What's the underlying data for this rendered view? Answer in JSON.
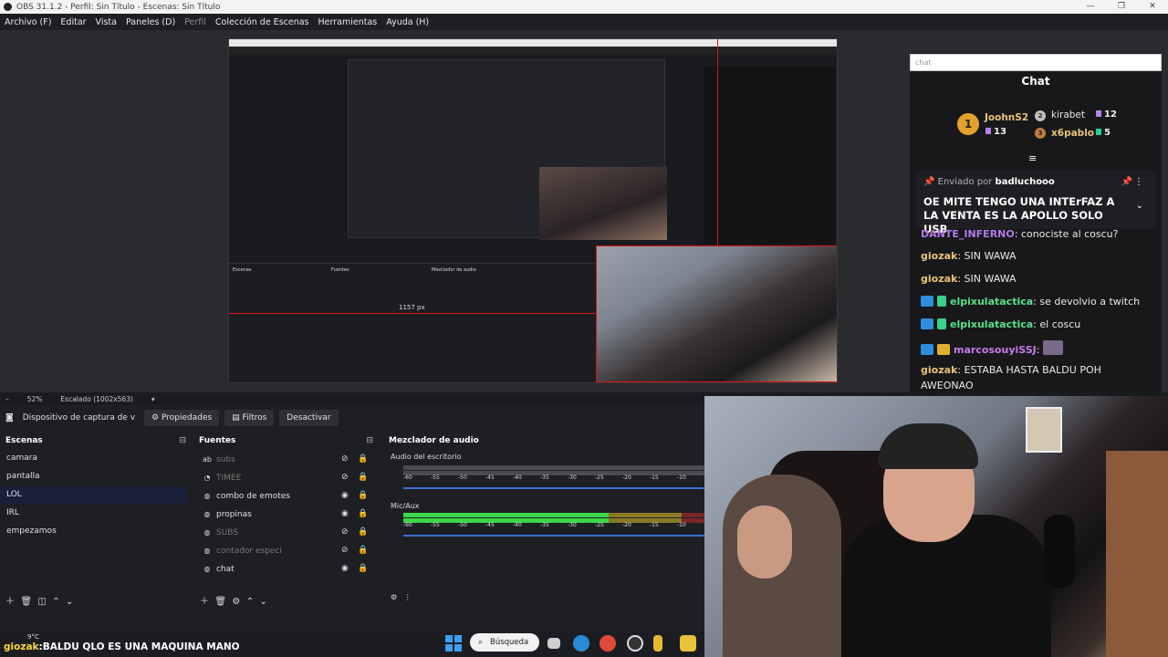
{
  "window": {
    "title": "OBS 31.1.2 - Perfil: Sin Título - Escenas: Sin Título",
    "controls": [
      "—",
      "❐",
      "✕"
    ]
  },
  "menu": [
    "Archivo (F)",
    "Editar",
    "Vista",
    "Paneles (D)",
    "Perfil",
    "Colección de Escenas",
    "Herramientas",
    "Ayuda (H)"
  ],
  "chat": {
    "input_text": "chat",
    "title": "Chat",
    "leaderboard": [
      {
        "rank": "1",
        "name": "JoohnS2",
        "count": "13"
      },
      {
        "rank": "2",
        "name": "kirabet",
        "count": "12"
      },
      {
        "rank": "3",
        "name": "x6pablo",
        "count": "5"
      }
    ],
    "pinned": {
      "prefix": "Enviado por",
      "author": "badluchooo",
      "text": "OE MITE TENGO UNA INTErFAZ A LA VENTA ES LA APOLLO SOLO USB"
    },
    "messages": [
      {
        "user": "DANTE_INFERNO",
        "text": "conociste al coscu?",
        "color": "#b07ae8"
      },
      {
        "user": "giozak",
        "text": "SIN WAWA",
        "color": "#e8c37a"
      },
      {
        "user": "giozak",
        "text": "SIN WAWA",
        "color": "#e8c37a"
      },
      {
        "user": "elpixulatactica",
        "text": "se devolvio a twitch",
        "color": "#59e08a"
      },
      {
        "user": "elpixulatactica",
        "text": "el coscu",
        "color": "#59e08a"
      },
      {
        "user": "marcosouyiSSJ",
        "text": "",
        "color": "#c77ae8"
      },
      {
        "user": "giozak",
        "text": "ESTABA HASTA BALDU POH",
        "color": "#e8c37a"
      },
      {
        "user": "",
        "text": "AWEONAO",
        "color": "#e8e8e8"
      }
    ]
  },
  "status": {
    "zoom": "52%",
    "scale": "Escalado (1002x563)"
  },
  "toolbar": {
    "source_name": "Dispositivo de captura de v",
    "properties": "Propiedades",
    "filters": "Filtros",
    "deactivate": "Desactivar"
  },
  "scenes": {
    "title": "Escenas",
    "items": [
      "camara",
      "pantalla",
      "LOL",
      "IRL",
      "empezamos"
    ],
    "selected_index": 2
  },
  "sources": {
    "title": "Fuentes",
    "items": [
      {
        "name": "subs",
        "visible": false
      },
      {
        "name": "TIMEE",
        "visible": false
      },
      {
        "name": "combo de emotes",
        "visible": true
      },
      {
        "name": "propinas",
        "visible": true
      },
      {
        "name": "SUBS",
        "visible": false
      },
      {
        "name": "contador especi",
        "visible": false
      },
      {
        "name": "chat",
        "visible": true
      }
    ]
  },
  "mixer": {
    "title": "Mezclador de audio",
    "channels": [
      {
        "name": "Audio del escritorio",
        "level": 0.0
      },
      {
        "name": "Mic/Aux",
        "level": 0.85
      }
    ],
    "ticks": [
      "-60",
      "-55",
      "-50",
      "-45",
      "-40",
      "-35",
      "-30",
      "-25",
      "-20",
      "-15",
      "-10"
    ]
  },
  "overlay": {
    "user": "giozak",
    "text": "BALDU QLO ES UNA MAQUINA MANO"
  },
  "taskbar": {
    "weather": "9°C",
    "search": "Búsqueda"
  },
  "nested_preview": {
    "pixel_label": "1157 px"
  }
}
